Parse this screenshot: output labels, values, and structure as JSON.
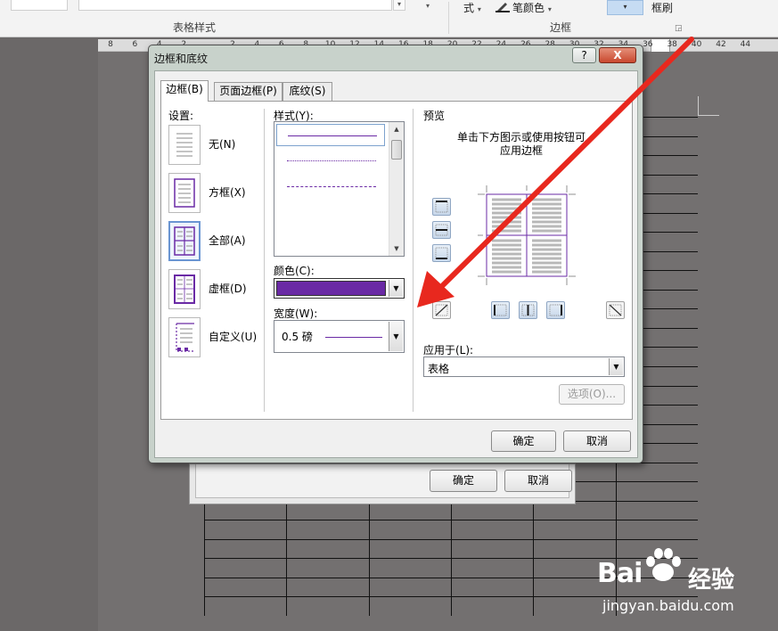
{
  "ribbon": {
    "table_styles_group": "表格样式",
    "borders_group": "边框",
    "style_button": "式",
    "pen_color": "笔颜色",
    "painter": "框刷"
  },
  "ruler": {
    "ticks": [
      "8",
      "6",
      "4",
      "2",
      "",
      "2",
      "4",
      "6",
      "8",
      "10",
      "12",
      "14",
      "16",
      "18",
      "20",
      "22",
      "24",
      "26",
      "28",
      "30",
      "32",
      "34",
      "36",
      "38",
      "40",
      "42",
      "44"
    ]
  },
  "dialog": {
    "title": "边框和底纹",
    "help": "?",
    "close": "X",
    "tabs": [
      {
        "label": "边框(B)"
      },
      {
        "label": "页面边框(P)"
      },
      {
        "label": "底纹(S)"
      }
    ],
    "settings_label": "设置:",
    "settings": [
      {
        "label": "无(N)"
      },
      {
        "label": "方框(X)"
      },
      {
        "label": "全部(A)"
      },
      {
        "label": "虚框(D)"
      },
      {
        "label": "自定义(U)"
      }
    ],
    "style_label": "样式(Y):",
    "color_label": "颜色(C):",
    "color_value": "#6a2aa5",
    "width_label": "宽度(W):",
    "width_value": "0.5 磅",
    "preview_label": "预览",
    "preview_instruction_1": "单击下方图示或使用按钮可",
    "preview_instruction_2": "应用边框",
    "apply_label": "应用于(L):",
    "apply_value": "表格",
    "options_button": "选项(O)...",
    "ok_button": "确定",
    "cancel_button": "取消"
  },
  "background_dialog": {
    "ok_button": "确定",
    "cancel_button": "取消"
  },
  "watermark": {
    "brand": "Bai",
    "brand_suffix": "经验",
    "url": "jingyan.baidu.com"
  },
  "colors": {
    "accent_purple": "#6a2aa5",
    "arrow_red": "#e8281e"
  }
}
